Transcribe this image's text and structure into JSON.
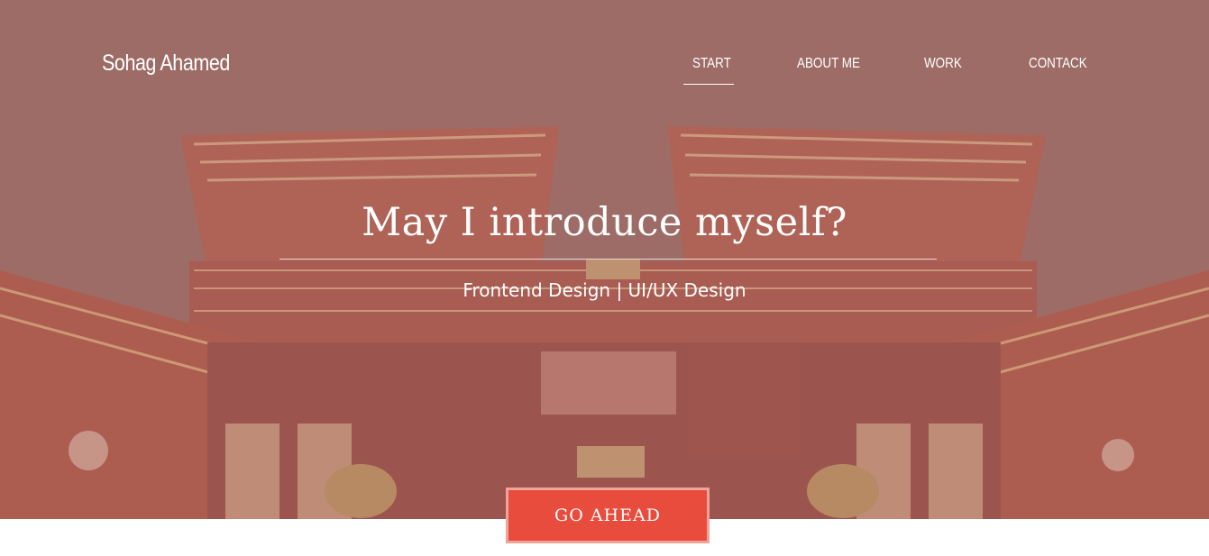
{
  "header": {
    "brand": "Sohag Ahamed",
    "nav": [
      {
        "label": "START",
        "active": true
      },
      {
        "label": "ABOUT ME",
        "active": false
      },
      {
        "label": "WORK",
        "active": false
      },
      {
        "label": "CONTACK",
        "active": false
      }
    ]
  },
  "hero": {
    "title": "May I introduce myself?",
    "subtitle": "Frontend Design | UI/UX Design",
    "cta_label": "GO AHEAD",
    "background_image": "red-pagoda-temple-photo"
  },
  "colors": {
    "accent": "#e84c3d",
    "accent_border": "#f0a39a",
    "overlay": "#aa7873",
    "text": "#ffffff"
  }
}
